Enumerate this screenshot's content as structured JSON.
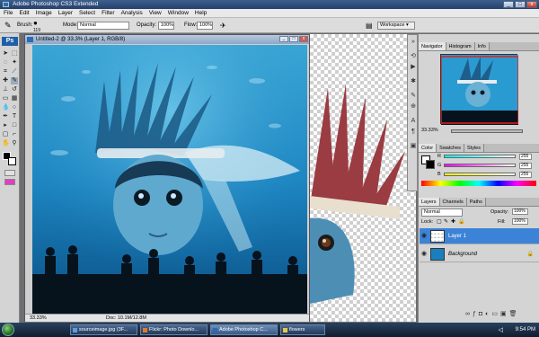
{
  "window": {
    "title": "Adobe Photoshop CS3 Extended",
    "min": "_",
    "max": "□",
    "close": "x"
  },
  "menu": [
    "File",
    "Edit",
    "Image",
    "Layer",
    "Select",
    "Filter",
    "Analysis",
    "View",
    "Window",
    "Help"
  ],
  "options": {
    "brush_label": "Brush:",
    "brush_size": "119",
    "mode_label": "Mode:",
    "mode_value": "Normal",
    "opacity_label": "Opacity:",
    "opacity_value": "100%",
    "flow_label": "Flow:",
    "flow_value": "100%",
    "workspace": "Workspace"
  },
  "document": {
    "title": "Untitled-2 @ 33.3% (Layer 1, RGB/8)",
    "zoom": "33.33%",
    "doc_size": "Doc: 10.1M/12.8M"
  },
  "navigator": {
    "tabs": [
      "Navigator",
      "Histogram",
      "Info"
    ],
    "zoom": "33.33%"
  },
  "color": {
    "tabs": [
      "Color",
      "Swatches",
      "Styles"
    ],
    "r_label": "R",
    "r_value": "255",
    "g_label": "G",
    "g_value": "255",
    "b_label": "B",
    "b_value": "255"
  },
  "layers": {
    "tabs": [
      "Layers",
      "Channels",
      "Paths"
    ],
    "blend_mode": "Normal",
    "opacity_label": "Opacity:",
    "opacity_value": "100%",
    "lock_label": "Lock:",
    "fill_label": "Fill:",
    "fill_value": "100%",
    "items": [
      {
        "name": "Layer 1",
        "selected": true
      },
      {
        "name": "Background",
        "selected": false
      }
    ]
  },
  "taskbar": {
    "buttons": [
      {
        "label": "sourceimage.jpg (3F..."
      },
      {
        "label": "Flickr: Photo Downlo..."
      },
      {
        "label": "Adobe Photoshop C..."
      },
      {
        "label": "flowers"
      }
    ],
    "clock": "9:54 PM"
  }
}
